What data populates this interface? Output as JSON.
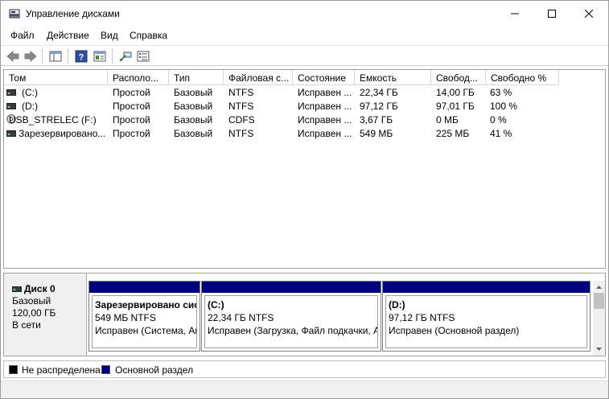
{
  "window": {
    "title": "Управление дисками"
  },
  "menu": [
    "Файл",
    "Действие",
    "Вид",
    "Справка"
  ],
  "volume_list": {
    "columns": [
      "Том",
      "Располо...",
      "Тип",
      "Файловая с...",
      "Состояние",
      "Емкость",
      "Свобод...",
      "Свободно %"
    ],
    "rows": [
      {
        "icon": "hard-drive-icon",
        "cells": [
          "(C:)",
          "Простой",
          "Базовый",
          "NTFS",
          "Исправен ...",
          "22,34 ГБ",
          "14,00 ГБ",
          "63 %"
        ]
      },
      {
        "icon": "hard-drive-icon",
        "cells": [
          "(D:)",
          "Простой",
          "Базовый",
          "NTFS",
          "Исправен ...",
          "97,12 ГБ",
          "97,01 ГБ",
          "100 %"
        ]
      },
      {
        "icon": "cd-drive-icon",
        "cells": [
          "USB_STRELEC (F:)",
          "Простой",
          "Базовый",
          "CDFS",
          "Исправен ...",
          "3,67 ГБ",
          "0 МБ",
          "0 %"
        ]
      },
      {
        "icon": "hard-drive-icon",
        "cells": [
          "Зарезервировано...",
          "Простой",
          "Базовый",
          "NTFS",
          "Исправен ...",
          "549 МБ",
          "225 МБ",
          "41 %"
        ]
      }
    ]
  },
  "disk": {
    "name": "Диск 0",
    "type": "Базовый",
    "size": "120,00 ГБ",
    "status": "В сети",
    "partitions": [
      {
        "title": "Зарезервировано сис",
        "size": "549 МБ NTFS",
        "status": "Исправен (Система, Ак"
      },
      {
        "title": "(C:)",
        "size": "22,34 ГБ NTFS",
        "status": "Исправен (Загрузка, Файл подкачки, А"
      },
      {
        "title": "(D:)",
        "size": "97,12 ГБ NTFS",
        "status": "Исправен (Основной раздел)"
      }
    ]
  },
  "legend": [
    {
      "label": "Не распределена",
      "color": "#000000"
    },
    {
      "label": "Основной раздел",
      "color": "#000080"
    }
  ]
}
